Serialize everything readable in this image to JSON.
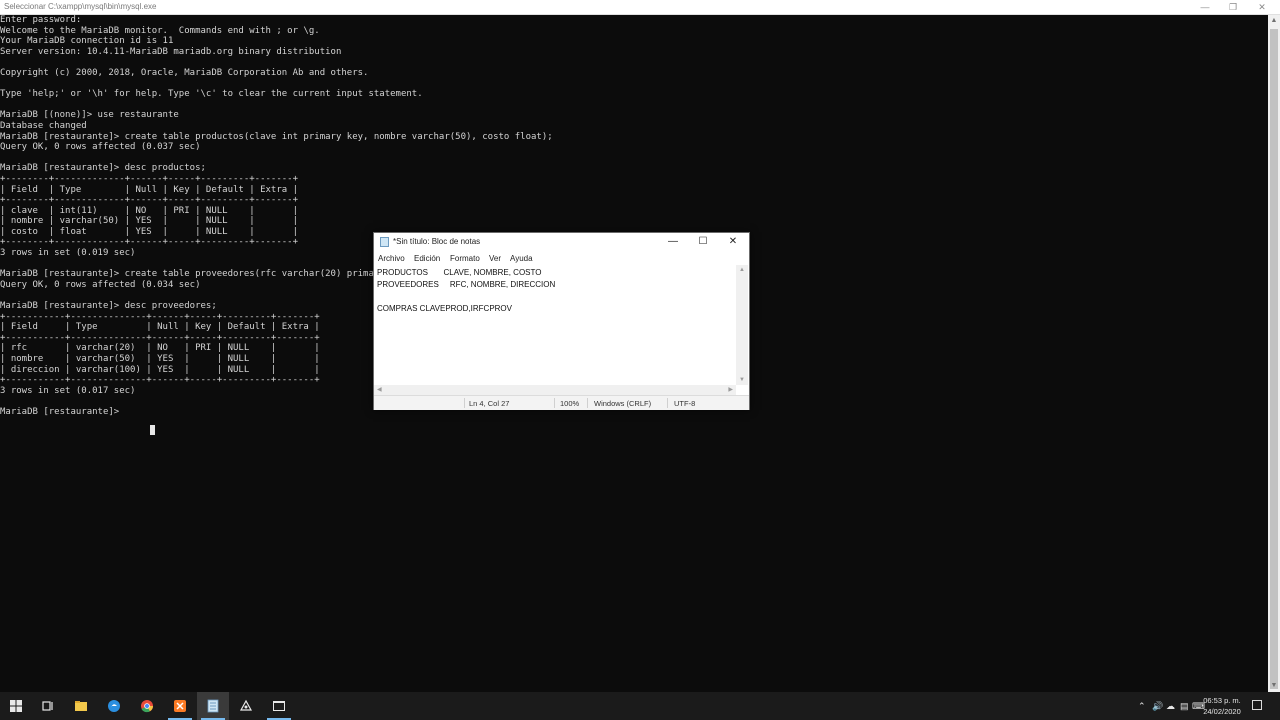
{
  "console": {
    "title": "Seleccionar C:\\xampp\\mysql\\bin\\mysql.exe",
    "lines": [
      "Enter password:",
      "Welcome to the MariaDB monitor.  Commands end with ; or \\g.",
      "Your MariaDB connection id is 11",
      "Server version: 10.4.11-MariaDB mariadb.org binary distribution",
      "",
      "Copyright (c) 2000, 2018, Oracle, MariaDB Corporation Ab and others.",
      "",
      "Type 'help;' or '\\h' for help. Type '\\c' to clear the current input statement.",
      "",
      "MariaDB [(none)]> use restaurante",
      "Database changed",
      "MariaDB [restaurante]> create table productos(clave int primary key, nombre varchar(50), costo float);",
      "Query OK, 0 rows affected (0.037 sec)",
      "",
      "MariaDB [restaurante]> desc productos;",
      "+--------+-------------+------+-----+---------+-------+",
      "| Field  | Type        | Null | Key | Default | Extra |",
      "+--------+-------------+------+-----+---------+-------+",
      "| clave  | int(11)     | NO   | PRI | NULL    |       |",
      "| nombre | varchar(50) | YES  |     | NULL    |       |",
      "| costo  | float       | YES  |     | NULL    |       |",
      "+--------+-------------+------+-----+---------+-------+",
      "3 rows in set (0.019 sec)",
      "",
      "MariaDB [restaurante]> create table proveedores(rfc varchar(20) primar",
      "Query OK, 0 rows affected (0.034 sec)",
      "",
      "MariaDB [restaurante]> desc proveedores;",
      "+-----------+--------------+------+-----+---------+-------+",
      "| Field     | Type         | Null | Key | Default | Extra |",
      "+-----------+--------------+------+-----+---------+-------+",
      "| rfc       | varchar(20)  | NO   | PRI | NULL    |       |",
      "| nombre    | varchar(50)  | YES  |     | NULL    |       |",
      "| direccion | varchar(100) | YES  |     | NULL    |       |",
      "+-----------+--------------+------+-----+---------+-------+",
      "3 rows in set (0.017 sec)",
      "",
      "MariaDB [restaurante]> "
    ]
  },
  "notepad": {
    "title": "*Sin título: Bloc de notas",
    "menu": [
      "Archivo",
      "Edición",
      "Formato",
      "Ver",
      "Ayuda"
    ],
    "content": "PRODUCTOS       CLAVE, NOMBRE, COSTO\nPROVEEDORES     RFC, NOMBRE, DIRECCION\n\nCOMPRAS CLAVEPROD,IRFCPROV",
    "status": {
      "position": "Ln 4, Col 27",
      "zoom": "100%",
      "line_ending": "Windows (CRLF)",
      "encoding": "UTF-8"
    }
  },
  "taskbar": {
    "clock_time": "06:53 p. m.",
    "clock_date": "24/02/2020",
    "apps": [
      "start-icon",
      "task-view-icon",
      "file-explorer-icon",
      "edge-icon",
      "chrome-icon",
      "xampp-icon",
      "notepad-icon",
      "mysql-workbench-icon",
      "console-icon"
    ]
  },
  "colors": {
    "console_bg": "#0c0c0c",
    "console_fg": "#d4d4d4",
    "taskbar_bg": "#1b1b1b",
    "accent": "#76b9ed"
  }
}
